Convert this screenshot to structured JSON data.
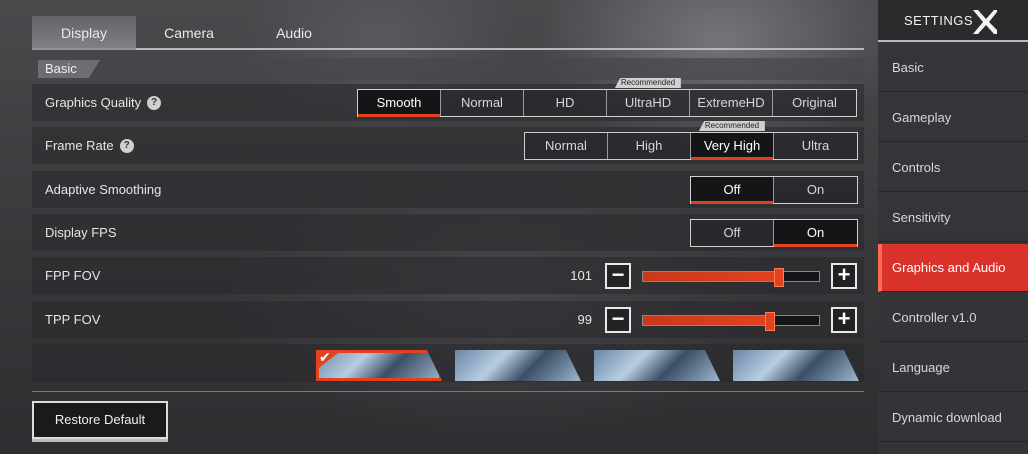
{
  "tabs": [
    {
      "label": "Display",
      "active": true
    },
    {
      "label": "Camera",
      "active": false
    },
    {
      "label": "Audio",
      "active": false
    }
  ],
  "section": {
    "label": "Basic"
  },
  "graphics_quality": {
    "label": "Graphics Quality",
    "options": [
      "Smooth",
      "Normal",
      "HD",
      "UltraHD",
      "ExtremeHD",
      "Original"
    ],
    "selected": "Smooth",
    "recommended": "Recommended"
  },
  "frame_rate": {
    "label": "Frame Rate",
    "options": [
      "Normal",
      "High",
      "Very High",
      "Ultra"
    ],
    "selected": "Very High",
    "recommended": "Recommended"
  },
  "adaptive_smoothing": {
    "label": "Adaptive Smoothing",
    "options": [
      "Off",
      "On"
    ],
    "selected": "Off"
  },
  "display_fps": {
    "label": "Display FPS",
    "options": [
      "Off",
      "On"
    ],
    "selected": "On"
  },
  "fpp_fov": {
    "label": "FPP FOV",
    "value": "101",
    "fraction": 0.77,
    "minus": "−",
    "plus": "+"
  },
  "tpp_fov": {
    "label": "TPP FOV",
    "value": "99",
    "fraction": 0.72,
    "minus": "−",
    "plus": "+"
  },
  "presets": {
    "selected_index": 0,
    "count": 4
  },
  "restore_label": "Restore Default",
  "sidebar": {
    "title": "SETTINGS",
    "items": [
      {
        "label": "Basic",
        "active": false
      },
      {
        "label": "Gameplay",
        "active": false
      },
      {
        "label": "Controls",
        "active": false
      },
      {
        "label": "Sensitivity",
        "active": false
      },
      {
        "label": "Graphics and Audio",
        "active": true
      },
      {
        "label": "Controller v1.0",
        "active": false
      },
      {
        "label": "Language",
        "active": false
      },
      {
        "label": "Dynamic download",
        "active": false
      }
    ]
  },
  "colors": {
    "accent": "#e2421e",
    "active_sidebar": "#d9322a"
  }
}
